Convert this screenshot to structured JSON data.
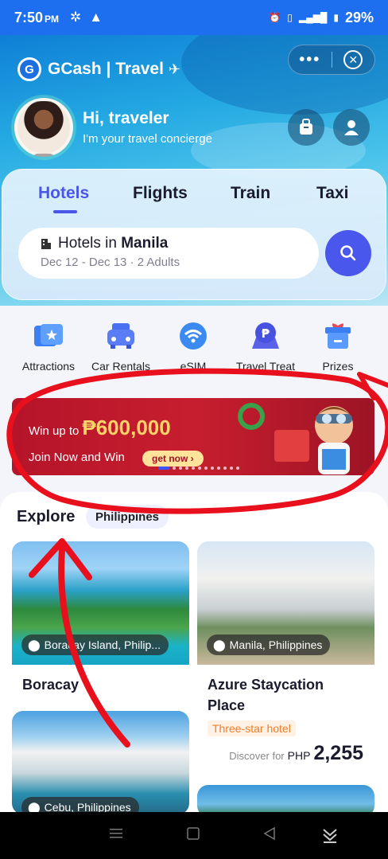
{
  "status_bar": {
    "time": "7:50",
    "ampm": "PM",
    "battery": "29%"
  },
  "header": {
    "brand": "GCash | Travel",
    "greeting": "Hi, traveler",
    "subtitle": "I'm your travel concierge"
  },
  "tabs": [
    "Hotels",
    "Flights",
    "Train",
    "Taxi"
  ],
  "search": {
    "prefix": "Hotels in",
    "city": "Manila",
    "details": "Dec 12 - Dec 13 · 2 Adults"
  },
  "categories": [
    "Attractions",
    "Car Rentals",
    "eSIM",
    "Travel Treat",
    "Prizes"
  ],
  "banner": {
    "win_text": "Win up to",
    "amount": "₱600,000",
    "join_text": "Join Now and Win",
    "cta": "get now ›"
  },
  "explore": {
    "title": "Explore",
    "filter_chip": "Philippines",
    "cards": [
      {
        "location": "Boracay Island, Philip...",
        "name": "Boracay"
      },
      {
        "location": "Manila, Philippines",
        "name": "Azure Staycation Place",
        "tag": "Three-star hotel",
        "price_prefix": "Discover for",
        "currency": "PHP",
        "price": "2,255"
      },
      {
        "location": "Cebu, Philippines"
      }
    ]
  },
  "colors": {
    "accent": "#4a56e8",
    "status_bar": "#1e6ff0",
    "banner": "#c71e2e",
    "annotation": "#e8101c"
  }
}
